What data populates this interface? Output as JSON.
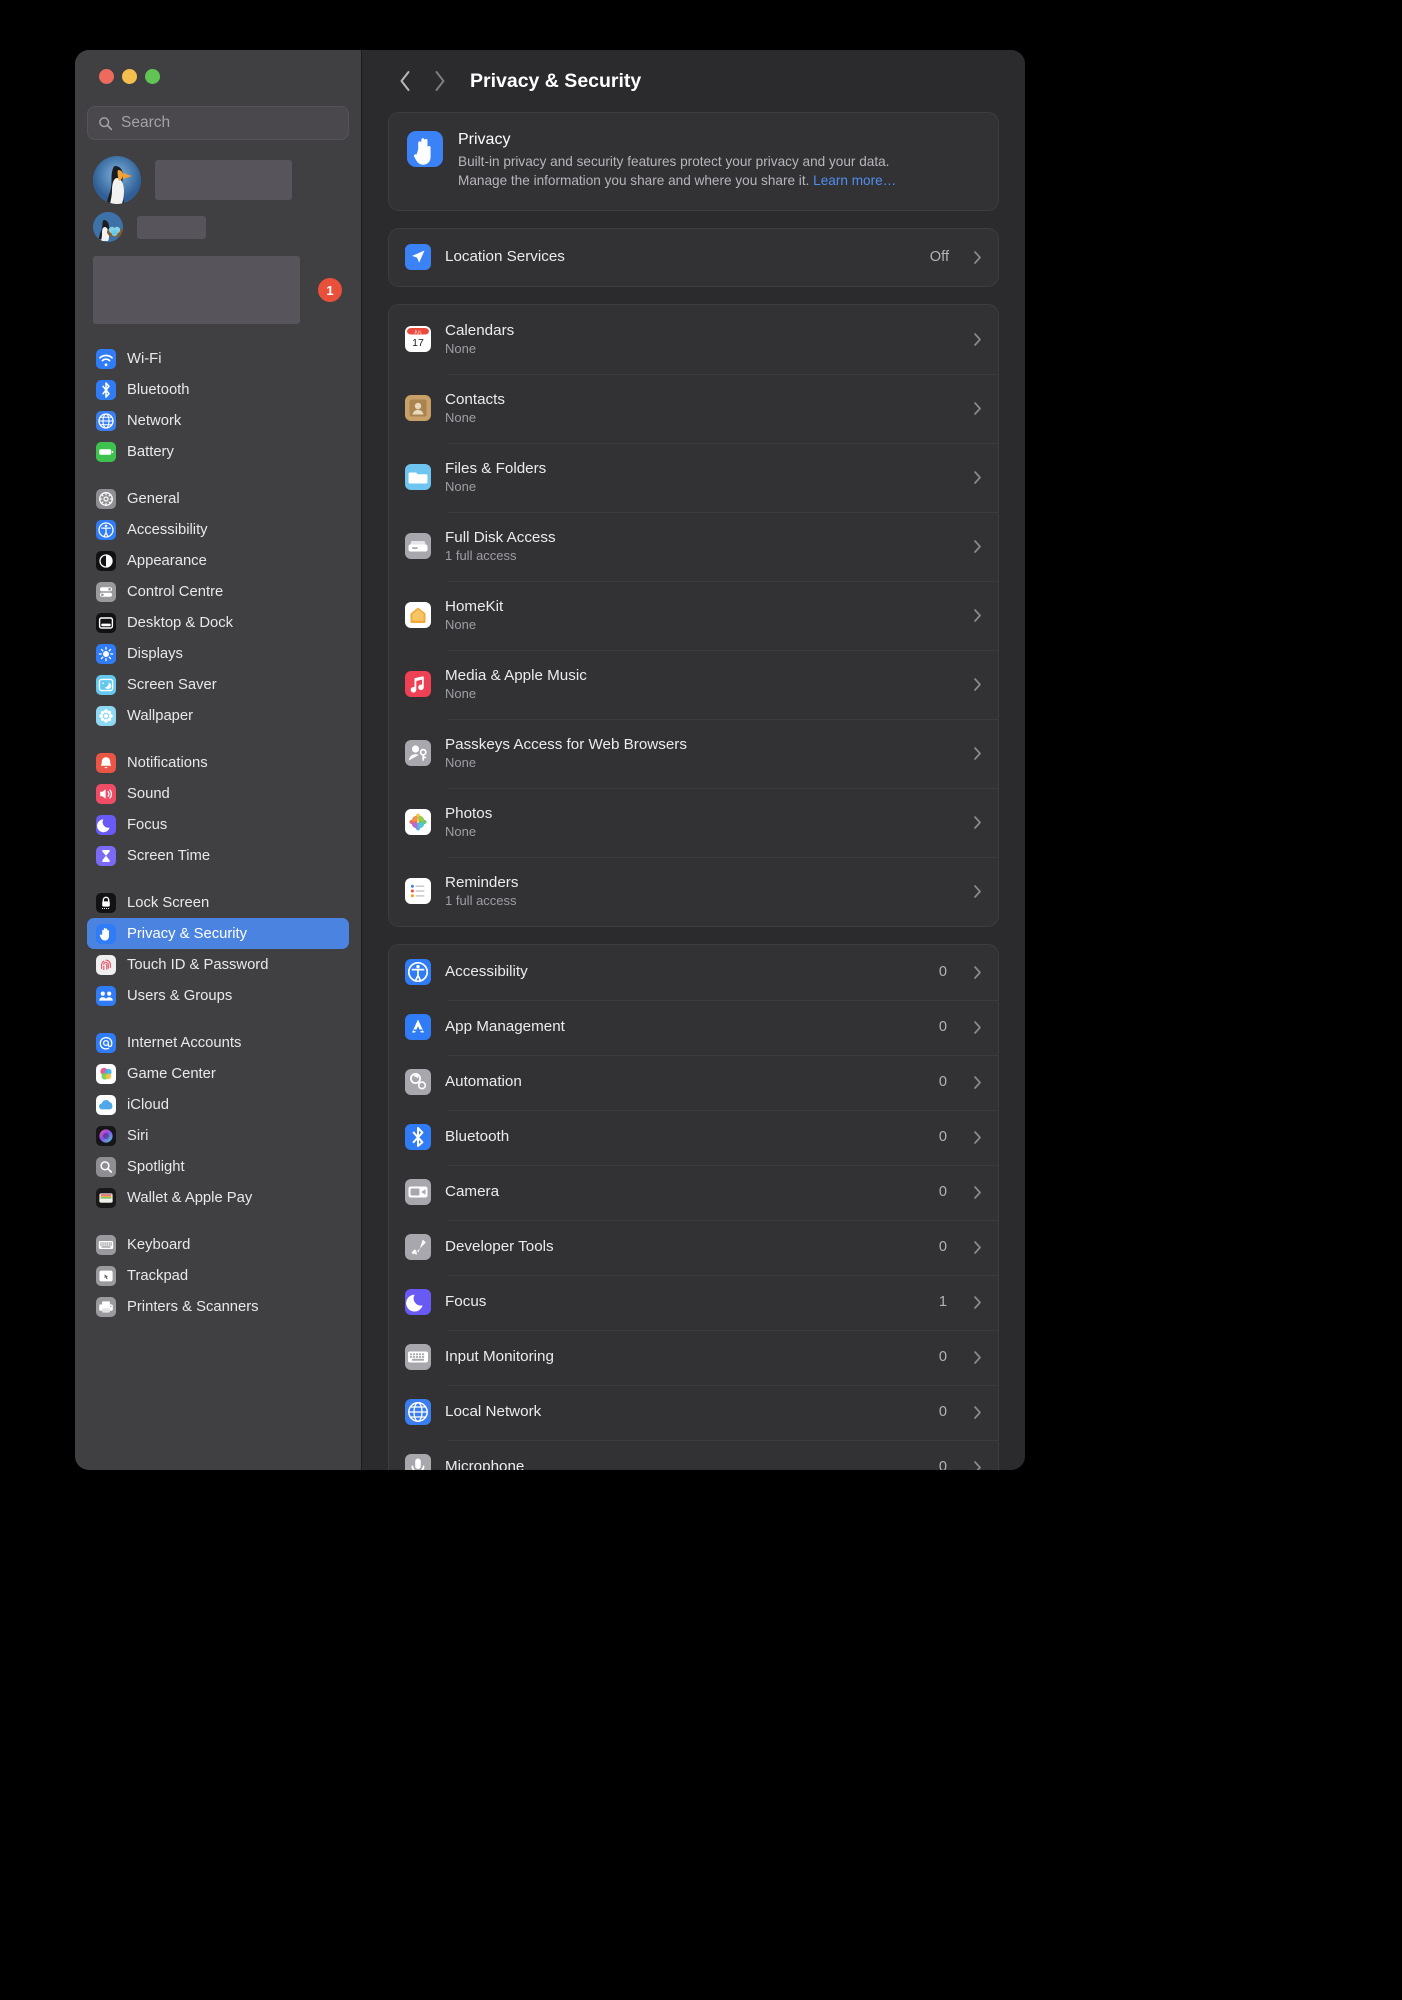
{
  "window": {
    "traffic_lights": [
      "close",
      "minimise",
      "zoom"
    ]
  },
  "sidebar": {
    "search": {
      "placeholder": "Search",
      "icon": "search-icon"
    },
    "account_badge": "1",
    "groups": [
      {
        "items": [
          {
            "label": "Wi-Fi",
            "icon": "wifi-icon"
          },
          {
            "label": "Bluetooth",
            "icon": "bluetooth-icon"
          },
          {
            "label": "Network",
            "icon": "network-globe-icon"
          },
          {
            "label": "Battery",
            "icon": "battery-icon"
          }
        ]
      },
      {
        "items": [
          {
            "label": "General",
            "icon": "gear-icon"
          },
          {
            "label": "Accessibility",
            "icon": "accessibility-icon"
          },
          {
            "label": "Appearance",
            "icon": "appearance-icon"
          },
          {
            "label": "Control Centre",
            "icon": "control-centre-icon"
          },
          {
            "label": "Desktop & Dock",
            "icon": "desktop-dock-icon"
          },
          {
            "label": "Displays",
            "icon": "displays-icon"
          },
          {
            "label": "Screen Saver",
            "icon": "screen-saver-icon"
          },
          {
            "label": "Wallpaper",
            "icon": "wallpaper-icon"
          }
        ]
      },
      {
        "items": [
          {
            "label": "Notifications",
            "icon": "notifications-bell-icon"
          },
          {
            "label": "Sound",
            "icon": "sound-speaker-icon"
          },
          {
            "label": "Focus",
            "icon": "focus-moon-icon"
          },
          {
            "label": "Screen Time",
            "icon": "screen-time-hourglass-icon"
          }
        ]
      },
      {
        "items": [
          {
            "label": "Lock Screen",
            "icon": "lock-screen-icon"
          },
          {
            "label": "Privacy & Security",
            "icon": "privacy-hand-icon",
            "selected": true
          },
          {
            "label": "Touch ID & Password",
            "icon": "touch-id-fingerprint-icon"
          },
          {
            "label": "Users & Groups",
            "icon": "users-groups-icon"
          }
        ]
      },
      {
        "items": [
          {
            "label": "Internet Accounts",
            "icon": "internet-accounts-at-icon"
          },
          {
            "label": "Game Center",
            "icon": "game-center-icon"
          },
          {
            "label": "iCloud",
            "icon": "icloud-icon"
          },
          {
            "label": "Siri",
            "icon": "siri-icon"
          },
          {
            "label": "Spotlight",
            "icon": "spotlight-search-icon"
          },
          {
            "label": "Wallet & Apple Pay",
            "icon": "wallet-icon"
          }
        ]
      },
      {
        "items": [
          {
            "label": "Keyboard",
            "icon": "keyboard-icon"
          },
          {
            "label": "Trackpad",
            "icon": "trackpad-icon"
          },
          {
            "label": "Printers & Scanners",
            "icon": "printer-icon"
          }
        ]
      }
    ]
  },
  "toolbar": {
    "back_icon": "chevron-left-icon",
    "forward_icon": "chevron-right-icon",
    "title": "Privacy & Security"
  },
  "privacy_banner": {
    "icon": "privacy-hand-icon",
    "title": "Privacy",
    "body_line1": "Built-in privacy and security features protect your privacy and your data.",
    "body_line2": "Manage the information you share and where you share it.",
    "link": "Learn more…"
  },
  "location_services": {
    "icon": "location-arrow-icon",
    "label": "Location Services",
    "value": "Off"
  },
  "permissions_card": [
    {
      "icon": "calendar-icon",
      "label": "Calendars",
      "sub": "None"
    },
    {
      "icon": "contacts-icon",
      "label": "Contacts",
      "sub": "None"
    },
    {
      "icon": "files-folders-icon",
      "label": "Files & Folders",
      "sub": "None"
    },
    {
      "icon": "full-disk-access-icon",
      "label": "Full Disk Access",
      "sub": "1 full access"
    },
    {
      "icon": "homekit-icon",
      "label": "HomeKit",
      "sub": "None"
    },
    {
      "icon": "media-apple-music-icon",
      "label": "Media & Apple Music",
      "sub": "None"
    },
    {
      "icon": "passkeys-icon",
      "label": "Passkeys Access for Web Browsers",
      "sub": "None"
    },
    {
      "icon": "photos-icon",
      "label": "Photos",
      "sub": "None"
    },
    {
      "icon": "reminders-icon",
      "label": "Reminders",
      "sub": "1 full access"
    }
  ],
  "access_card": [
    {
      "icon": "accessibility-icon",
      "label": "Accessibility",
      "count": "0"
    },
    {
      "icon": "app-management-icon",
      "label": "App Management",
      "count": "0"
    },
    {
      "icon": "automation-gears-icon",
      "label": "Automation",
      "count": "0"
    },
    {
      "icon": "bluetooth-icon",
      "label": "Bluetooth",
      "count": "0"
    },
    {
      "icon": "camera-icon",
      "label": "Camera",
      "count": "0"
    },
    {
      "icon": "developer-tools-icon",
      "label": "Developer Tools",
      "count": "0"
    },
    {
      "icon": "focus-moon-icon",
      "label": "Focus",
      "count": "1"
    },
    {
      "icon": "input-monitoring-icon",
      "label": "Input Monitoring",
      "count": "0"
    },
    {
      "icon": "local-network-icon",
      "label": "Local Network",
      "count": "0"
    },
    {
      "icon": "microphone-icon",
      "label": "Microphone",
      "count": "0"
    }
  ],
  "colors": {
    "accent": "#4a84e0",
    "badge": "#e8503a",
    "link": "#4f8ff0",
    "window_bg": "#2b2a2c",
    "sidebar_bg": "#403f42",
    "card_bg": "#323134"
  }
}
